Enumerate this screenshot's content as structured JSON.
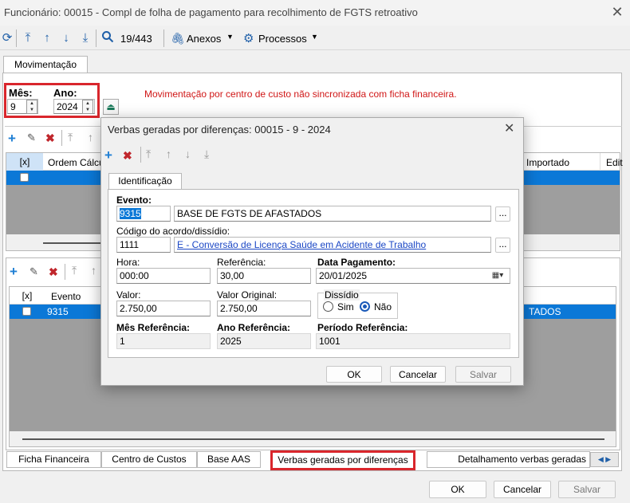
{
  "window": {
    "title": "Funcionário: 00015 - Compl de folha de pagamento para recolhimento de FGTS retroativo"
  },
  "toolbar": {
    "record_position": "19/443",
    "anexos_label": "Anexos",
    "processos_label": "Processos"
  },
  "tabs": {
    "movimentacao": "Movimentação"
  },
  "period": {
    "mes_label": "Mês:",
    "mes_value": "9",
    "ano_label": "Ano:",
    "ano_value": "2024"
  },
  "warning": "Movimentação por centro de custo não sincronizada com ficha financeira.",
  "upper_grid": {
    "columns": [
      "[x]",
      "Ordem Cálculo",
      "Importado",
      "Edit"
    ]
  },
  "lower_grid": {
    "columns": [
      "[x]",
      "Evento"
    ],
    "row": {
      "evento": "9315",
      "tail_text": "TADOS"
    }
  },
  "bottom_tabs": [
    "Ficha Financeira",
    "Centro de Custos",
    "Base AAS",
    "Verbas geradas por diferenças",
    "Detalhamento verbas geradas"
  ],
  "main_buttons": {
    "ok": "OK",
    "cancelar": "Cancelar",
    "salvar": "Salvar"
  },
  "dialog": {
    "title": "Verbas geradas por diferenças: 00015 - 9 - 2024",
    "tab": "Identificação",
    "evento_label": "Evento:",
    "evento_code": "9315",
    "evento_desc": "BASE DE FGTS DE AFASTADOS",
    "acordo_label": "Código do acordo/dissídio:",
    "acordo_code": "1111",
    "acordo_desc": "E - Conversão de Licença Saúde em Acidente de Trabalho",
    "hora_label": "Hora:",
    "hora_value": "000:00",
    "referencia_label": "Referência:",
    "referencia_value": "30,00",
    "data_pagamento_label": "Data Pagamento:",
    "data_pagamento_value": "20/01/2025",
    "valor_label": "Valor:",
    "valor_value": "2.750,00",
    "valor_original_label": "Valor Original:",
    "valor_original_value": "2.750,00",
    "dissidio_label": "Dissídio",
    "dissidio_sim": "Sim",
    "dissidio_nao": "Não",
    "dissidio_selected": "Não",
    "mes_ref_label": "Mês Referência:",
    "mes_ref_value": "1",
    "ano_ref_label": "Ano Referência:",
    "ano_ref_value": "2025",
    "periodo_ref_label": "Período Referência:",
    "periodo_ref_value": "1001",
    "ellipsis": "...",
    "ok": "OK",
    "cancelar": "Cancelar",
    "salvar": "Salvar"
  },
  "colors": {
    "accent_blue": "#0b78d7",
    "highlight_red": "#d9262c",
    "icon_blue": "#1f5fa8",
    "delete_red": "#c0262c"
  }
}
